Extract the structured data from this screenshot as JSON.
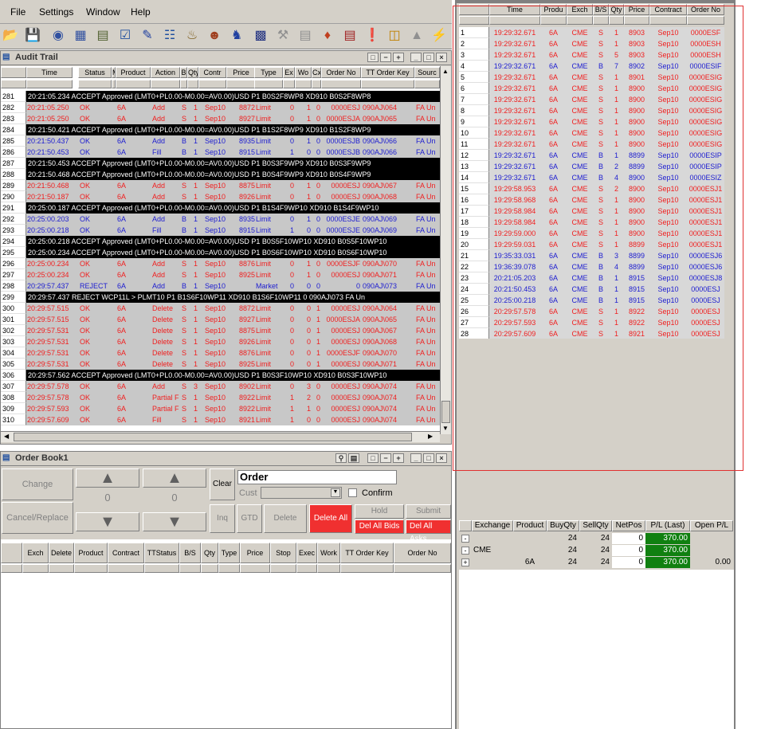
{
  "menu": {
    "file": "File",
    "settings": "Settings",
    "window": "Window",
    "help": "Help"
  },
  "toolbar_icons": [
    "open-folder-icon",
    "save-icon",
    "binoculars-icon",
    "grid-icon",
    "book-icon",
    "checklist-icon",
    "pencil-icon",
    "document-icon",
    "bell-icon",
    "people-icon",
    "knight-icon",
    "matrix-icon",
    "gavel-icon",
    "ruler-icon",
    "eraser-icon",
    "abacus-icon",
    "stop-icon",
    "calculator-icon",
    "chart-icon",
    "plug-icon"
  ],
  "audit": {
    "title": "Audit Trail",
    "columns": [
      "Time",
      "Status",
      "M",
      "Product",
      "Action",
      "B",
      "Qty",
      "Contr",
      "Price",
      "Type",
      "Ex",
      "Wo",
      "Cx",
      "Order No",
      "TT Order Key",
      "Sourc"
    ],
    "rows": [
      {
        "n": "281",
        "style": "black",
        "text": "20:21:05.234  ACCEPT  Approved (LMT0+PL0.00-M0.00=AV0.00)USD P1 B0S2F8WP8 XD910 B0S2F8WP8"
      },
      {
        "n": "282",
        "style": "red",
        "cells": [
          "20:21:05.250",
          "OK",
          "",
          "6A",
          "Add",
          "S",
          "1",
          "Sep10",
          "8872",
          "Limit",
          "0",
          "1",
          "0",
          "0000ESJ",
          "090AJ\\064",
          "FA Un"
        ]
      },
      {
        "n": "283",
        "style": "red",
        "cells": [
          "20:21:05.250",
          "OK",
          "",
          "6A",
          "Add",
          "S",
          "1",
          "Sep10",
          "8927",
          "Limit",
          "0",
          "1",
          "0",
          "0000ESJA",
          "090AJ\\065",
          "FA Un"
        ]
      },
      {
        "n": "284",
        "style": "black",
        "text": "20:21:50.421  ACCEPT  Approved (LMT0+PL0.00-M0.00=AV0.00)USD P1 B1S2F8WP9 XD910 B1S2F8WP9"
      },
      {
        "n": "285",
        "style": "blue",
        "cells": [
          "20:21:50.437",
          "OK",
          "",
          "6A",
          "Add",
          "B",
          "1",
          "Sep10",
          "8935",
          "Limit",
          "0",
          "1",
          "0",
          "0000ESJB",
          "090AJ\\066",
          "FA Un"
        ]
      },
      {
        "n": "286",
        "style": "blue",
        "cells": [
          "20:21:50.453",
          "OK",
          "",
          "6A",
          "Fill",
          "B",
          "1",
          "Sep10",
          "8915",
          "Limit",
          "1",
          "0",
          "0",
          "0000ESJB",
          "090AJ\\066",
          "FA Un"
        ]
      },
      {
        "n": "287",
        "style": "black",
        "text": "20:21:50.453  ACCEPT  Approved (LMT0+PL0.00-M0.00=AV0.00)USD P1 B0S3F9WP9 XD910 B0S3F9WP9"
      },
      {
        "n": "288",
        "style": "black",
        "text": "20:21:50.468  ACCEPT  Approved (LMT0+PL0.00-M0.00=AV0.00)USD P1 B0S4F9WP9 XD910 B0S4F9WP9"
      },
      {
        "n": "289",
        "style": "red",
        "cells": [
          "20:21:50.468",
          "OK",
          "",
          "6A",
          "Add",
          "S",
          "1",
          "Sep10",
          "8875",
          "Limit",
          "0",
          "1",
          "0",
          "0000ESJ",
          "090AJ\\067",
          "FA Un"
        ]
      },
      {
        "n": "290",
        "style": "red",
        "cells": [
          "20:21:50.187",
          "OK",
          "",
          "6A",
          "Add",
          "S",
          "1",
          "Sep10",
          "8926",
          "Limit",
          "0",
          "1",
          "0",
          "0000ESJ",
          "090AJ\\068",
          "FA Un"
        ]
      },
      {
        "n": "291",
        "style": "black",
        "text": "20:25:00.187  ACCEPT  Approved (LMT0+PL0.00-M0.00=AV0.00)USD P1 B1S4F9WP10 XD910 B1S4F9WP10"
      },
      {
        "n": "292",
        "style": "blue",
        "cells": [
          "20:25:00.203",
          "OK",
          "",
          "6A",
          "Add",
          "B",
          "1",
          "Sep10",
          "8935",
          "Limit",
          "0",
          "1",
          "0",
          "0000ESJE",
          "090AJ\\069",
          "FA Un"
        ]
      },
      {
        "n": "293",
        "style": "blue",
        "cells": [
          "20:25:00.218",
          "OK",
          "",
          "6A",
          "Fill",
          "B",
          "1",
          "Sep10",
          "8915",
          "Limit",
          "1",
          "0",
          "0",
          "0000ESJE",
          "090AJ\\069",
          "FA Un"
        ]
      },
      {
        "n": "294",
        "style": "black",
        "text": "20:25:00.218  ACCEPT  Approved (LMT0+PL0.00-M0.00=AV0.00)USD P1 B0S5F10WP10 XD910 B0S5F10WP10"
      },
      {
        "n": "295",
        "style": "black",
        "text": "20:25:00.234  ACCEPT  Approved (LMT0+PL0.00-M0.00=AV0.00)USD P1 B0S6F10WP10 XD910 B0S6F10WP10"
      },
      {
        "n": "296",
        "style": "red",
        "cells": [
          "20:25:00.234",
          "OK",
          "",
          "6A",
          "Add",
          "S",
          "1",
          "Sep10",
          "8876",
          "Limit",
          "0",
          "1",
          "0",
          "0000ESJF",
          "090AJ\\070",
          "FA Un"
        ]
      },
      {
        "n": "297",
        "style": "red",
        "cells": [
          "20:25:00.234",
          "OK",
          "",
          "6A",
          "Add",
          "S",
          "1",
          "Sep10",
          "8925",
          "Limit",
          "0",
          "1",
          "0",
          "0000ESJ",
          "090AJ\\071",
          "FA Un"
        ]
      },
      {
        "n": "298",
        "style": "blue",
        "cells": [
          "20:29:57.437",
          "REJECT",
          "",
          "6A",
          "Add",
          "B",
          "1",
          "Sep10",
          "",
          "Market",
          "0",
          "0",
          "0",
          "0",
          "090AJ\\073",
          "FA Un"
        ]
      },
      {
        "n": "299",
        "style": "black",
        "text": "20:29:57.437  REJECT  WCP11L > PLMT10 P1 B1S6F10WP11 XD910 B1S6F10WP11            0  090AJ\\073    FA Un"
      },
      {
        "n": "300",
        "style": "red",
        "cells": [
          "20:29:57.515",
          "OK",
          "",
          "6A",
          "Delete",
          "S",
          "1",
          "Sep10",
          "8872",
          "Limit",
          "0",
          "0",
          "1",
          "0000ESJ",
          "090AJ\\064",
          "FA Un"
        ]
      },
      {
        "n": "301",
        "style": "red",
        "cells": [
          "20:29:57.515",
          "OK",
          "",
          "6A",
          "Delete",
          "S",
          "1",
          "Sep10",
          "8927",
          "Limit",
          "0",
          "0",
          "1",
          "0000ESJA",
          "090AJ\\065",
          "FA Un"
        ]
      },
      {
        "n": "302",
        "style": "red",
        "cells": [
          "20:29:57.531",
          "OK",
          "",
          "6A",
          "Delete",
          "S",
          "1",
          "Sep10",
          "8875",
          "Limit",
          "0",
          "0",
          "1",
          "0000ESJ",
          "090AJ\\067",
          "FA Un"
        ]
      },
      {
        "n": "303",
        "style": "red",
        "cells": [
          "20:29:57.531",
          "OK",
          "",
          "6A",
          "Delete",
          "S",
          "1",
          "Sep10",
          "8926",
          "Limit",
          "0",
          "0",
          "1",
          "0000ESJ",
          "090AJ\\068",
          "FA Un"
        ]
      },
      {
        "n": "304",
        "style": "red",
        "cells": [
          "20:29:57.531",
          "OK",
          "",
          "6A",
          "Delete",
          "S",
          "1",
          "Sep10",
          "8876",
          "Limit",
          "0",
          "0",
          "1",
          "0000ESJF",
          "090AJ\\070",
          "FA Un"
        ]
      },
      {
        "n": "305",
        "style": "red",
        "cells": [
          "20:29:57.531",
          "OK",
          "",
          "6A",
          "Delete",
          "S",
          "1",
          "Sep10",
          "8925",
          "Limit",
          "0",
          "0",
          "1",
          "0000ESJ",
          "090AJ\\071",
          "FA Un"
        ]
      },
      {
        "n": "306",
        "style": "black",
        "text": "20:29:57.562  ACCEPT  Approved (LMT0+PL0.00-M0.00=AV0.00)USD P1 B0S3F10WP10 XD910 B0S3F10WP10"
      },
      {
        "n": "307",
        "style": "red",
        "cells": [
          "20:29:57.578",
          "OK",
          "",
          "6A",
          "Add",
          "S",
          "3",
          "Sep10",
          "8902",
          "Limit",
          "0",
          "3",
          "0",
          "0000ESJ",
          "090AJ\\074",
          "FA Un"
        ]
      },
      {
        "n": "308",
        "style": "red",
        "cells": [
          "20:29:57.578",
          "OK",
          "",
          "6A",
          "Partial F",
          "S",
          "1",
          "Sep10",
          "8922",
          "Limit",
          "1",
          "2",
          "0",
          "0000ESJ",
          "090AJ\\074",
          "FA Un"
        ]
      },
      {
        "n": "309",
        "style": "red",
        "cells": [
          "20:29:57.593",
          "OK",
          "",
          "6A",
          "Partial F",
          "S",
          "1",
          "Sep10",
          "8922",
          "Limit",
          "1",
          "1",
          "0",
          "0000ESJ",
          "090AJ\\074",
          "FA Un"
        ]
      },
      {
        "n": "310",
        "style": "red",
        "cells": [
          "20:29:57.609",
          "OK",
          "",
          "6A",
          "Fill",
          "S",
          "1",
          "Sep10",
          "8921",
          "Limit",
          "1",
          "0",
          "0",
          "0000ESJ",
          "090AJ\\074",
          "FA Un"
        ]
      }
    ]
  },
  "orderbook": {
    "title": "Order Book1",
    "change": "Change",
    "cancel_replace": "Cancel/Replace",
    "qty1": "0",
    "qty2": "0",
    "clear": "Clear",
    "order_label": "Order",
    "cust_label": "Cust",
    "confirm": "Confirm",
    "inq": "Inq",
    "gtd": "GTD",
    "delete": "Delete",
    "delete_all": "Delete All",
    "hold": "Hold",
    "submit": "Submit",
    "del_all_bids": "Del All Bids",
    "del_all_asks": "Del All Asks",
    "columns": [
      "Exch",
      "Delete",
      "Product",
      "Contract",
      "TTStatus",
      "B/S",
      "Qty",
      "Type",
      "Price",
      "Stop Prc",
      "Exec Qty",
      "Work Qty",
      "TT Order Key",
      "Order No"
    ]
  },
  "fills": {
    "columns": [
      "Time",
      "Produ",
      "Exch",
      "B/S",
      "Qty",
      "Price",
      "Contract",
      "Order No"
    ],
    "rows": [
      [
        "1",
        "19:29:32.671",
        "6A",
        "CME",
        "S",
        "1",
        "8903",
        "Sep10",
        "0000ESF",
        "red"
      ],
      [
        "2",
        "19:29:32.671",
        "6A",
        "CME",
        "S",
        "1",
        "8903",
        "Sep10",
        "0000ESH",
        "red"
      ],
      [
        "3",
        "19:29:32.671",
        "6A",
        "CME",
        "S",
        "5",
        "8903",
        "Sep10",
        "0000ESH",
        "red"
      ],
      [
        "4",
        "19:29:32.671",
        "6A",
        "CME",
        "B",
        "7",
        "8902",
        "Sep10",
        "0000ESIF",
        "blue"
      ],
      [
        "5",
        "19:29:32.671",
        "6A",
        "CME",
        "S",
        "1",
        "8901",
        "Sep10",
        "0000ESIG",
        "red"
      ],
      [
        "6",
        "19:29:32.671",
        "6A",
        "CME",
        "S",
        "1",
        "8900",
        "Sep10",
        "0000ESIG",
        "red"
      ],
      [
        "7",
        "19:29:32.671",
        "6A",
        "CME",
        "S",
        "1",
        "8900",
        "Sep10",
        "0000ESIG",
        "red"
      ],
      [
        "8",
        "19:29:32.671",
        "6A",
        "CME",
        "S",
        "1",
        "8900",
        "Sep10",
        "0000ESIG",
        "red"
      ],
      [
        "9",
        "19:29:32.671",
        "6A",
        "CME",
        "S",
        "1",
        "8900",
        "Sep10",
        "0000ESIG",
        "red"
      ],
      [
        "10",
        "19:29:32.671",
        "6A",
        "CME",
        "S",
        "1",
        "8900",
        "Sep10",
        "0000ESIG",
        "red"
      ],
      [
        "11",
        "19:29:32.671",
        "6A",
        "CME",
        "S",
        "1",
        "8900",
        "Sep10",
        "0000ESIG",
        "red"
      ],
      [
        "12",
        "19:29:32.671",
        "6A",
        "CME",
        "B",
        "1",
        "8899",
        "Sep10",
        "0000ESIP",
        "blue"
      ],
      [
        "13",
        "19:29:32.671",
        "6A",
        "CME",
        "B",
        "2",
        "8899",
        "Sep10",
        "0000ESIP",
        "blue"
      ],
      [
        "14",
        "19:29:32.671",
        "6A",
        "CME",
        "B",
        "4",
        "8900",
        "Sep10",
        "0000ESIZ",
        "blue"
      ],
      [
        "15",
        "19:29:58.953",
        "6A",
        "CME",
        "S",
        "2",
        "8900",
        "Sep10",
        "0000ESJ1",
        "red"
      ],
      [
        "16",
        "19:29:58.968",
        "6A",
        "CME",
        "S",
        "1",
        "8900",
        "Sep10",
        "0000ESJ1",
        "red"
      ],
      [
        "17",
        "19:29:58.984",
        "6A",
        "CME",
        "S",
        "1",
        "8900",
        "Sep10",
        "0000ESJ1",
        "red"
      ],
      [
        "18",
        "19:29:58.984",
        "6A",
        "CME",
        "S",
        "1",
        "8900",
        "Sep10",
        "0000ESJ1",
        "red"
      ],
      [
        "19",
        "19:29:59.000",
        "6A",
        "CME",
        "S",
        "1",
        "8900",
        "Sep10",
        "0000ESJ1",
        "red"
      ],
      [
        "20",
        "19:29:59.031",
        "6A",
        "CME",
        "S",
        "1",
        "8899",
        "Sep10",
        "0000ESJ1",
        "red"
      ],
      [
        "21",
        "19:35:33.031",
        "6A",
        "CME",
        "B",
        "3",
        "8899",
        "Sep10",
        "0000ESJ6",
        "blue"
      ],
      [
        "22",
        "19:36:39.078",
        "6A",
        "CME",
        "B",
        "4",
        "8899",
        "Sep10",
        "0000ESJ6",
        "blue"
      ],
      [
        "23",
        "20:21:05.203",
        "6A",
        "CME",
        "B",
        "1",
        "8915",
        "Sep10",
        "0000ESJ8",
        "blue"
      ],
      [
        "24",
        "20:21:50.453",
        "6A",
        "CME",
        "B",
        "1",
        "8915",
        "Sep10",
        "0000ESJ",
        "blue"
      ],
      [
        "25",
        "20:25:00.218",
        "6A",
        "CME",
        "B",
        "1",
        "8915",
        "Sep10",
        "0000ESJ",
        "blue"
      ],
      [
        "26",
        "20:29:57.578",
        "6A",
        "CME",
        "S",
        "1",
        "8922",
        "Sep10",
        "0000ESJ",
        "red"
      ],
      [
        "27",
        "20:29:57.593",
        "6A",
        "CME",
        "S",
        "1",
        "8922",
        "Sep10",
        "0000ESJ",
        "red"
      ],
      [
        "28",
        "20:29:57.609",
        "6A",
        "CME",
        "S",
        "1",
        "8921",
        "Sep10",
        "0000ESJ",
        "red"
      ]
    ]
  },
  "positions": {
    "columns": [
      "Exchange",
      "Product",
      "BuyQty",
      "SellQty",
      "NetPos",
      "P/L (Last)",
      "Open P/L"
    ],
    "rows": [
      {
        "exp": "-",
        "exch": "",
        "product": "",
        "buy": "24",
        "sell": "24",
        "net": "0",
        "pl": "370.00",
        "open": ""
      },
      {
        "exp": "-",
        "exch": "CME",
        "product": "",
        "buy": "24",
        "sell": "24",
        "net": "0",
        "pl": "370.00",
        "open": ""
      },
      {
        "exp": "+",
        "exch": "",
        "product": "6A",
        "buy": "24",
        "sell": "24",
        "net": "0",
        "pl": "370.00",
        "open": "0.00"
      }
    ]
  },
  "colors": {
    "sell": "#f02020",
    "buy": "#2020d0",
    "pl_green": "#108010",
    "delete_all": "#f03030"
  }
}
